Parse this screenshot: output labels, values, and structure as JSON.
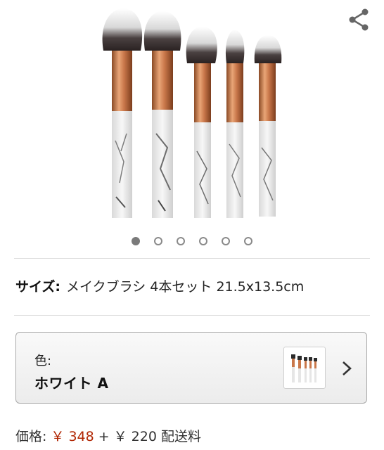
{
  "product": {
    "images_count": 6,
    "active_image_index": 0
  },
  "icons": {
    "share": "share-icon",
    "chevron": "chevron-right-icon"
  },
  "size": {
    "label": "サイズ:",
    "value": "メイクブラシ 4本セット 21.5x13.5cm"
  },
  "color": {
    "label": "色:",
    "value": "ホワイト A"
  },
  "price": {
    "label": "価格:",
    "amount": "￥ 348",
    "plus": "+",
    "shipping": "￥ 220 配送料"
  },
  "colors": {
    "price": "#b12704",
    "ferrule": "#c9774a",
    "bristle_dark": "#2b2b2b"
  }
}
